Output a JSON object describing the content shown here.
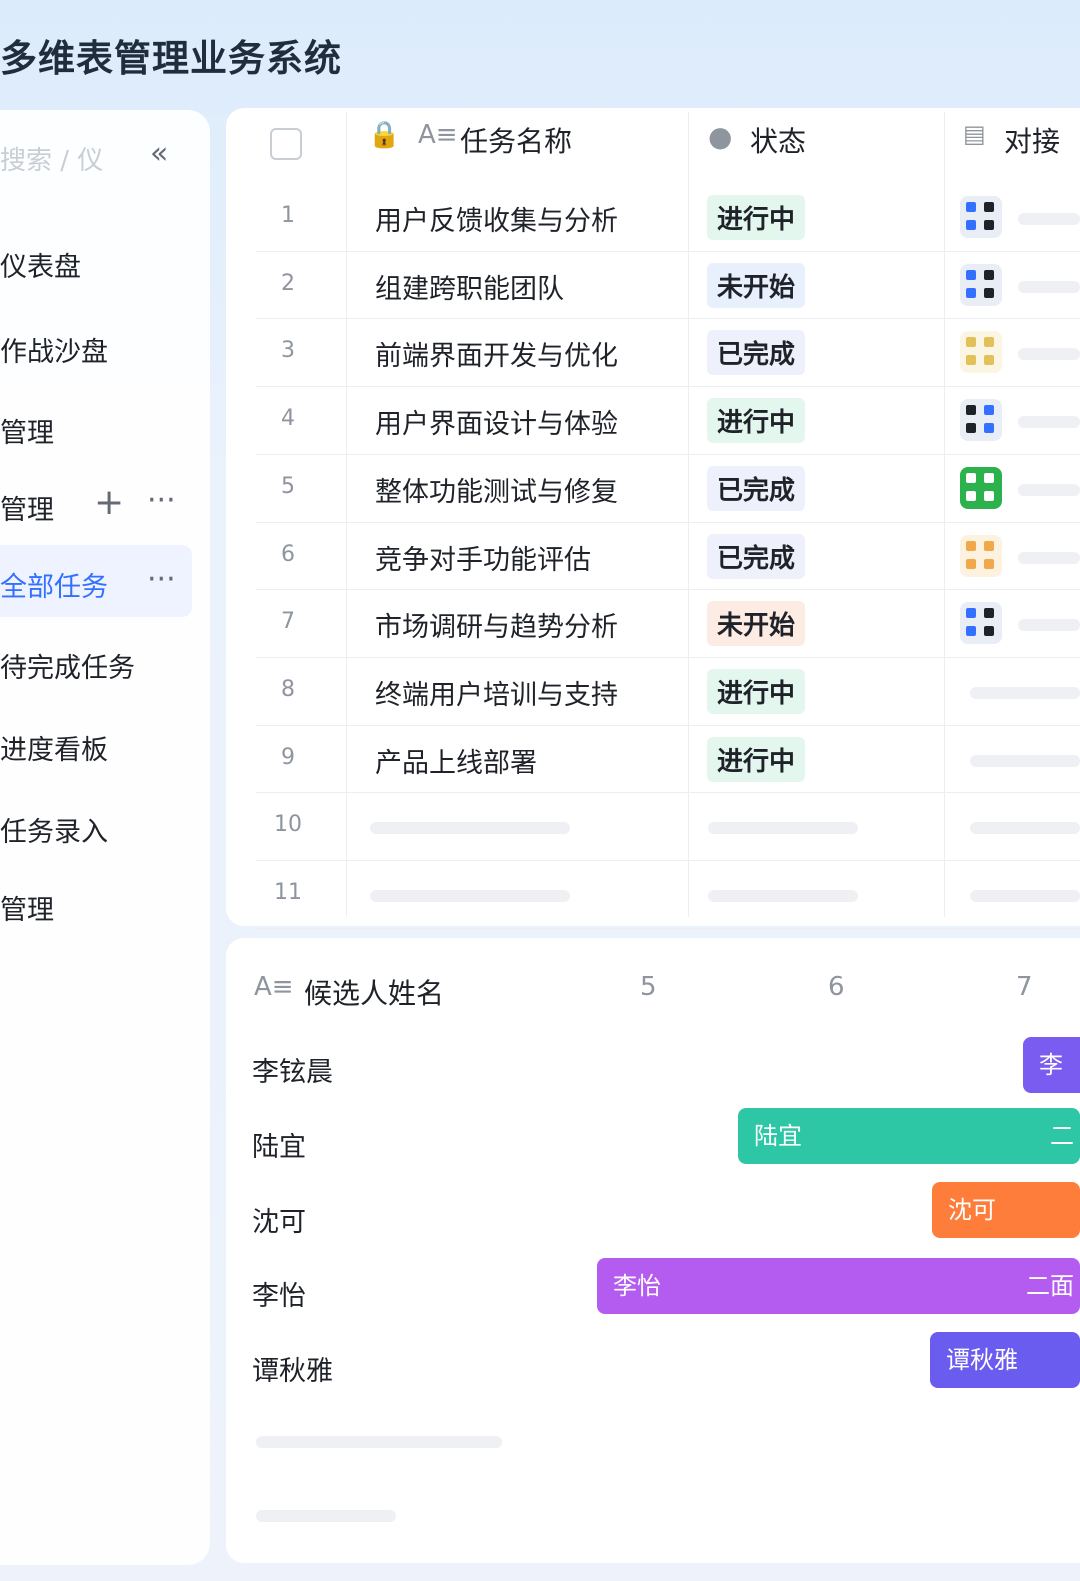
{
  "app": {
    "title": "多维表管理业务系统"
  },
  "sidebar": {
    "search_placeholder": "搜索 / 仪",
    "collapse_glyph": "«",
    "items": [
      {
        "label": "仪表盘"
      },
      {
        "label": "作战沙盘"
      },
      {
        "label": "管理"
      },
      {
        "label": "管理"
      },
      {
        "label": "全部任务"
      },
      {
        "label": "待完成任务"
      },
      {
        "label": "进度看板"
      },
      {
        "label": "任务录入"
      },
      {
        "label": "管理"
      }
    ],
    "add_glyph": "+",
    "more_glyph": "···"
  },
  "table": {
    "headers": {
      "task_name": "任务名称",
      "status": "状态",
      "contact": "对接"
    },
    "rows": [
      {
        "num": "1",
        "name": "用户反馈收集与分析",
        "status": "进行中"
      },
      {
        "num": "2",
        "name": "组建跨职能团队",
        "status": "未开始"
      },
      {
        "num": "3",
        "name": "前端界面开发与优化",
        "status": "已完成"
      },
      {
        "num": "4",
        "name": "用户界面设计与体验",
        "status": "进行中"
      },
      {
        "num": "5",
        "name": "整体功能测试与修复",
        "status": "已完成"
      },
      {
        "num": "6",
        "name": "竞争对手功能评估",
        "status": "已完成"
      },
      {
        "num": "7",
        "name": "市场调研与趋势分析",
        "status": "未开始"
      },
      {
        "num": "8",
        "name": "终端用户培训与支持",
        "status": "进行中"
      },
      {
        "num": "9",
        "name": "产品上线部署",
        "status": "进行中"
      },
      {
        "num": "10"
      },
      {
        "num": "11"
      }
    ],
    "status_colors": {
      "进行中": {
        "fg": "#1f2329",
        "bg": "#e3f7ef"
      },
      "未开始": {
        "fg": "#1f2329",
        "bg": "#e8f0fd"
      },
      "已完成": {
        "fg": "#1f2329",
        "bg": "#eef0fb"
      },
      "未开始-alt": {
        "fg": "#1f2329",
        "bg": "#fdece4"
      }
    }
  },
  "gantt": {
    "header": "候选人姓名",
    "days": [
      "5",
      "6",
      "7"
    ],
    "people": [
      {
        "name": "李铉晨",
        "bar_label": "李",
        "color": "#7b5cf0"
      },
      {
        "name": "陆宜",
        "bar_label": "陆宜",
        "bar_end": "二",
        "color": "#2ec7a5"
      },
      {
        "name": "沈可",
        "bar_label": "沈可",
        "color": "#ff7d3b"
      },
      {
        "name": "李怡",
        "bar_label": "李怡",
        "bar_end": "二面",
        "color": "#b45cf0"
      },
      {
        "name": "谭秋雅",
        "bar_label": "谭秋雅",
        "color": "#6b5cf0"
      }
    ]
  }
}
